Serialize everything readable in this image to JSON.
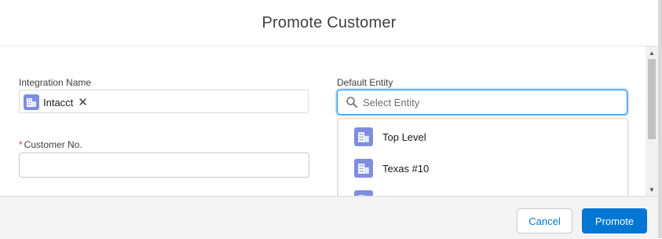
{
  "modal": {
    "title": "Promote Customer"
  },
  "form": {
    "integration_name": {
      "label": "Integration Name",
      "pill": {
        "label": "Intacct",
        "icon": "building-icon",
        "remove_icon": "close-icon"
      }
    },
    "customer_no": {
      "required_marker": "*",
      "label": "Customer No.",
      "value": ""
    },
    "default_entity": {
      "label": "Default Entity",
      "placeholder": "Select Entity",
      "search_icon": "search-icon",
      "options": [
        {
          "label": "Top Level",
          "icon": "building-icon"
        },
        {
          "label": "Texas #10",
          "icon": "building-icon"
        },
        {
          "label": "",
          "icon": "building-icon"
        }
      ]
    }
  },
  "footer": {
    "cancel_label": "Cancel",
    "promote_label": "Promote"
  },
  "colors": {
    "brand": "#0176d3",
    "icon_bg": "#7f8de1",
    "required": "#c23934",
    "focus_border": "#1b96ff"
  }
}
